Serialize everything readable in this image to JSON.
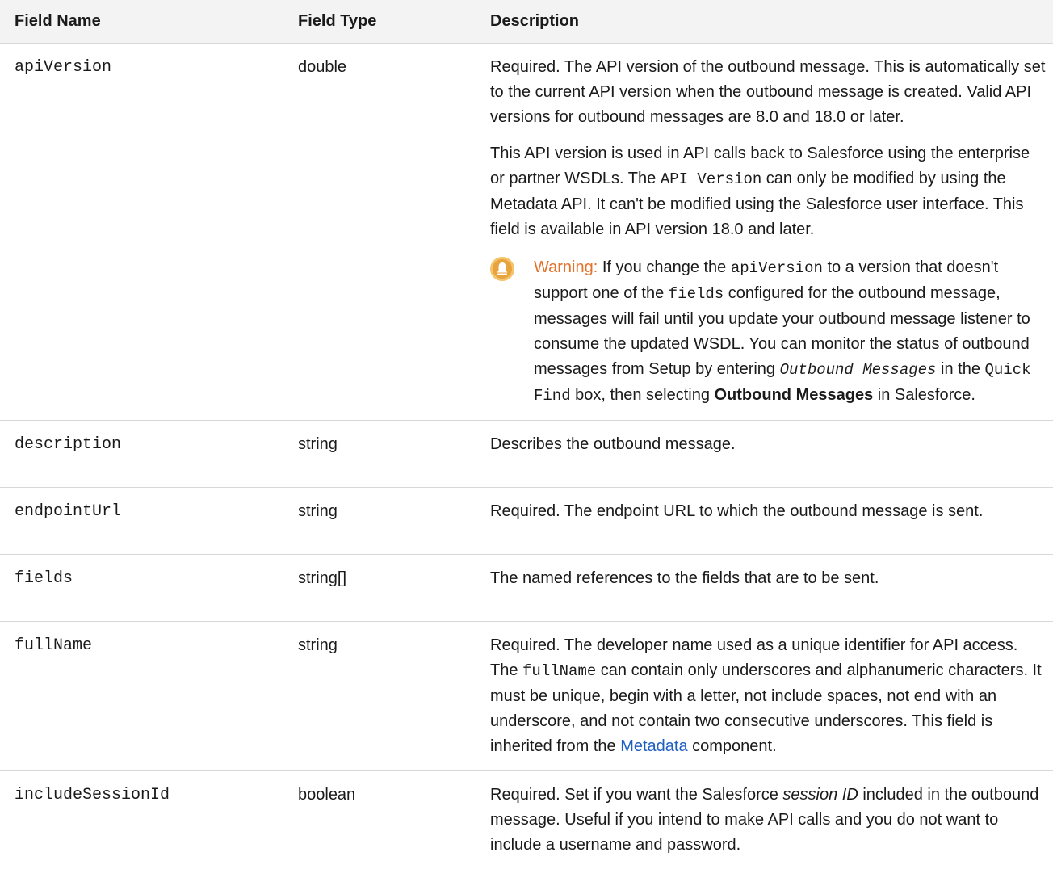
{
  "headers": {
    "field_name": "Field Name",
    "field_type": "Field Type",
    "description": "Description"
  },
  "warning_icon": "warning-bell-icon",
  "accent_colors": {
    "warning": "#e4722a",
    "link": "#1f5fc2",
    "warning_icon_bg": "#f4c36a"
  },
  "rows": [
    {
      "name": "apiVersion",
      "type": "double",
      "p1": "Required. The API version of the outbound message. This is automatically set to the current API version when the outbound message is created. Valid API versions for outbound messages are 8.0 and 18.0 or later.",
      "p2_a": "This API version is used in API calls back to Salesforce using the enterprise or partner WSDLs. The ",
      "p2_code": "API Version",
      "p2_b": " can only be modified by using the Metadata API. It can't be modified using the Salesforce user interface. This field is available in API version 18.0 and later.",
      "warning": {
        "label": "Warning:",
        "t1": " If you change the ",
        "c1": "apiVersion",
        "t2": " to a version that doesn't support one of the ",
        "c2": "fields",
        "t3": " configured for the outbound message, messages will fail until you update your outbound message listener to consume the updated WSDL. You can monitor the status of outbound messages from Setup by entering ",
        "c3": "Outbound Messages",
        "t4": " in the ",
        "c4": "Quick Find",
        "t5": " box, then selecting ",
        "b1": "Outbound Messages",
        "t6": " in Salesforce."
      }
    },
    {
      "name": "description",
      "type": "string",
      "desc": "Describes the outbound message."
    },
    {
      "name": "endpointUrl",
      "type": "string",
      "desc": "Required. The endpoint URL to which the outbound message is sent."
    },
    {
      "name": "fields",
      "type": "string[]",
      "desc": "The named references to the fields that are to be sent."
    },
    {
      "name": "fullName",
      "type": "string",
      "d_a": "Required. The developer name used as a unique identifier for API access. The ",
      "d_code": "fullName",
      "d_b": " can contain only underscores and alphanumeric characters. It must be unique, begin with a letter, not include spaces, not end with an underscore, and not contain two consecutive underscores. This field is inherited from the ",
      "d_link": "Metadata",
      "d_c": " component."
    },
    {
      "name": "includeSessionId",
      "type": "boolean",
      "d_a": "Required. Set if you want the Salesforce ",
      "d_em": "session ID",
      "d_b": " included in the outbound message. Useful if you intend to make API calls and you do not want to include a username and password."
    }
  ]
}
